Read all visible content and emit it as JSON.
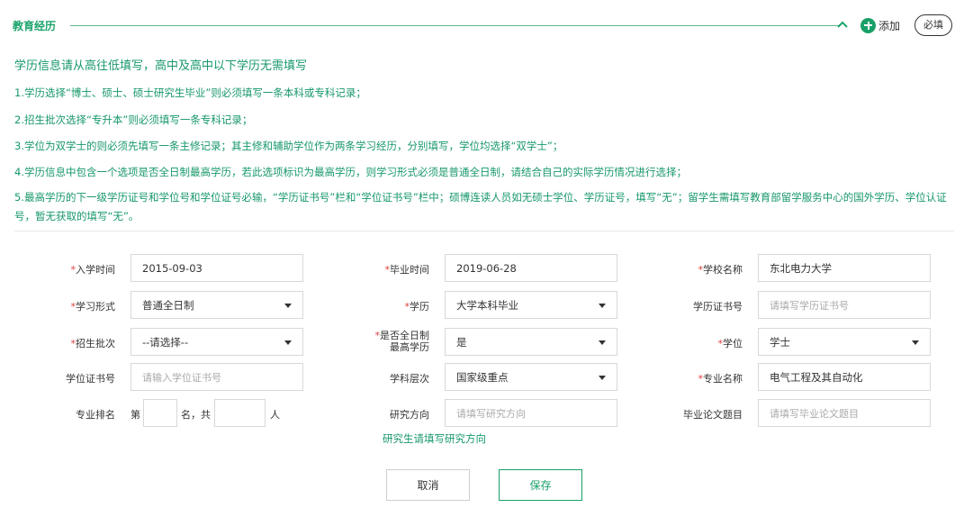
{
  "section": {
    "title": "教育经历",
    "add_label": "添加",
    "required_label": "必填"
  },
  "notice": {
    "title": "学历信息请从高往低填写，高中及高中以下学历无需填写",
    "items": [
      "1.学历选择“博士、硕士、硕士研究生毕业”则必须填写一条本科或专科记录；",
      "2.招生批次选择“专升本”则必须填写一条专科记录；",
      "3.学位为双学士的则必须先填写一条主修记录；其主修和辅助学位作为两条学习经历，分别填写，学位均选择“双学士”；",
      "4.学历信息中包含一个选项是否全日制最高学历，若此选项标识为最高学历，则学习形式必须是普通全日制，请结合自己的实际学历情况进行选择；",
      "5.最高学历的下一级学历证号和学位号和学位证号必输，“学历证书号”栏和“学位证书号”栏中；硕博连读人员如无硕士学位、学历证号，填写“无”；留学生需填写教育部留学服务中心的国外学历、学位认证号，暂无获取的填写“无”。"
    ]
  },
  "form": {
    "required_mark": "*",
    "enroll_date": {
      "label": "入学时间",
      "value": "2015-09-03"
    },
    "grad_date": {
      "label": "毕业时间",
      "value": "2019-06-28"
    },
    "school": {
      "label": "学校名称",
      "value": "东北电力大学"
    },
    "study_mode": {
      "label": "学习形式",
      "value": "普通全日制"
    },
    "education": {
      "label": "学历",
      "value": "大学本科毕业"
    },
    "diploma_no": {
      "label": "学历证书号",
      "placeholder": "请填写学历证书号"
    },
    "batch": {
      "label": "招生批次",
      "value": "--请选择--"
    },
    "highest_fulltime": {
      "label_line1": "是否全日制",
      "label_line2": "最高学历",
      "value": "是"
    },
    "degree": {
      "label": "学位",
      "value": "学士"
    },
    "degree_cert_no": {
      "label": "学位证书号",
      "placeholder": "请输入学位证书号"
    },
    "discipline_level": {
      "label": "学科层次",
      "value": "国家级重点"
    },
    "major": {
      "label": "专业名称",
      "value": "电气工程及其自动化"
    },
    "rank": {
      "label": "专业排名",
      "prefix": "第",
      "middle": "名，共",
      "suffix": "人"
    },
    "research": {
      "label": "研究方向",
      "placeholder": "请填写研究方向",
      "hint": "研究生请填写研究方向"
    },
    "thesis": {
      "label": "毕业论文题目",
      "placeholder": "请填写毕业论文题目"
    }
  },
  "buttons": {
    "cancel": "取消",
    "save": "保存"
  },
  "colors": {
    "accent": "#18a068",
    "required": "#e03c3c"
  }
}
